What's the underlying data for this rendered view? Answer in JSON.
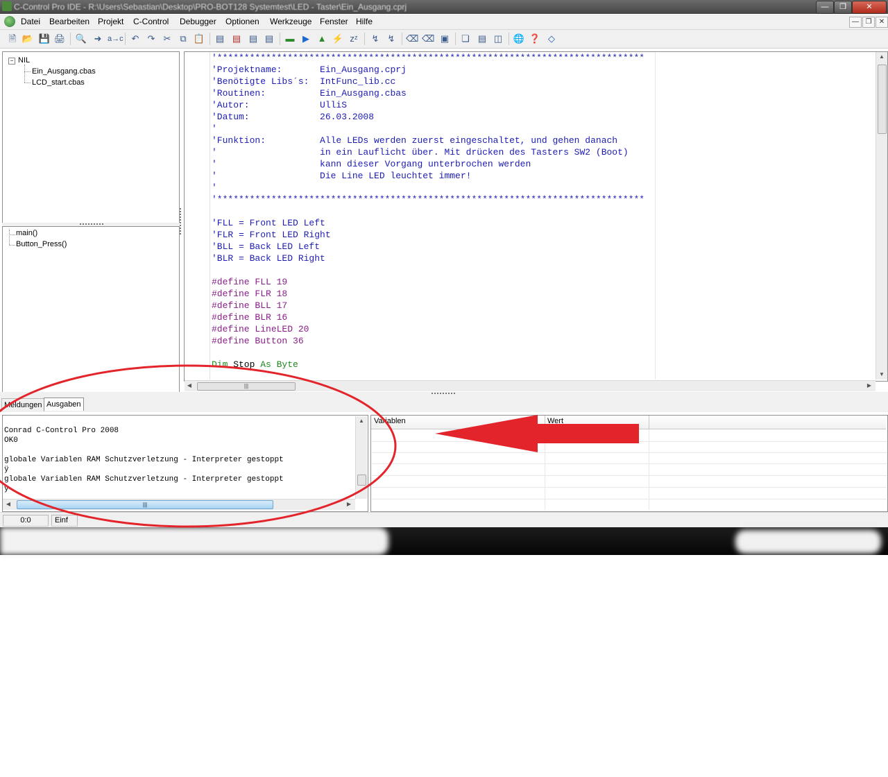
{
  "window": {
    "title": "C-Control Pro IDE - R:\\Users\\Sebastian\\Desktop\\PRO-BOT128 Systemtest\\LED - Taster\\Ein_Ausgang.cprj"
  },
  "menu": [
    "Datei",
    "Bearbeiten",
    "Projekt",
    "C-Control",
    "Debugger",
    "Optionen",
    "Werkzeuge",
    "Fenster",
    "Hilfe"
  ],
  "project_tree": {
    "root": "NIL",
    "files": [
      "Ein_Ausgang.cbas",
      "LCD_start.cbas"
    ]
  },
  "function_tree": {
    "items": [
      "main()",
      "Button_Press()"
    ]
  },
  "editor": {
    "lines": [
      {
        "cls": "cm",
        "text": "'*******************************************************************************"
      },
      {
        "cls": "cm",
        "text": "'Projektname:       Ein_Ausgang.cprj"
      },
      {
        "cls": "cm",
        "text": "'Benötigte Libs´s:  IntFunc_lib.cc"
      },
      {
        "cls": "cm",
        "text": "'Routinen:          Ein_Ausgang.cbas"
      },
      {
        "cls": "cm",
        "text": "'Autor:             UlliS"
      },
      {
        "cls": "cm",
        "text": "'Datum:             26.03.2008"
      },
      {
        "cls": "cm",
        "text": "'"
      },
      {
        "cls": "cm",
        "text": "'Funktion:          Alle LEDs werden zuerst eingeschaltet, und gehen danach"
      },
      {
        "cls": "cm",
        "text": "'                   in ein Lauflicht über. Mit drücken des Tasters SW2 (Boot)"
      },
      {
        "cls": "cm",
        "text": "'                   kann dieser Vorgang unterbrochen werden"
      },
      {
        "cls": "cm",
        "text": "'                   Die Line LED leuchtet immer!"
      },
      {
        "cls": "cm",
        "text": "'"
      },
      {
        "cls": "cm",
        "text": "'*******************************************************************************"
      },
      {
        "cls": "",
        "text": ""
      },
      {
        "cls": "cm",
        "text": "'FLL = Front LED Left"
      },
      {
        "cls": "cm",
        "text": "'FLR = Front LED Right"
      },
      {
        "cls": "cm",
        "text": "'BLL = Back LED Left"
      },
      {
        "cls": "cm",
        "text": "'BLR = Back LED Right"
      },
      {
        "cls": "",
        "text": ""
      },
      {
        "cls": "pp",
        "text": "#define FLL 19"
      },
      {
        "cls": "pp",
        "text": "#define FLR 18"
      },
      {
        "cls": "pp",
        "text": "#define BLL 17"
      },
      {
        "cls": "pp",
        "text": "#define BLR 16"
      },
      {
        "cls": "pp",
        "text": "#define LineLED 20"
      },
      {
        "cls": "pp",
        "text": "#define Button 36"
      },
      {
        "cls": "",
        "text": ""
      }
    ],
    "dim_line": {
      "kw1": "Dim",
      "name": " Stop ",
      "kw2": "As",
      "type": " Byte"
    }
  },
  "output_tabs": {
    "messages": "Meldungen",
    "output": "Ausgaben"
  },
  "output_lines": [
    "Conrad C-Control Pro 2008",
    "OK0",
    "",
    "globale Variablen RAM Schutzverletzung - Interpreter gestoppt",
    "ÿ",
    "globale Variablen RAM Schutzverletzung - Interpreter gestoppt",
    "ÿ"
  ],
  "variables": {
    "col_name": "Variablen",
    "col_value": "Wert"
  },
  "status": {
    "position": "0:0",
    "mode": "Einf"
  },
  "colors": {
    "annotation_red": "#e3242b",
    "comment": "#1c1cb4",
    "preprocessor": "#8a1d8a",
    "keyword": "#1c8a1c"
  }
}
